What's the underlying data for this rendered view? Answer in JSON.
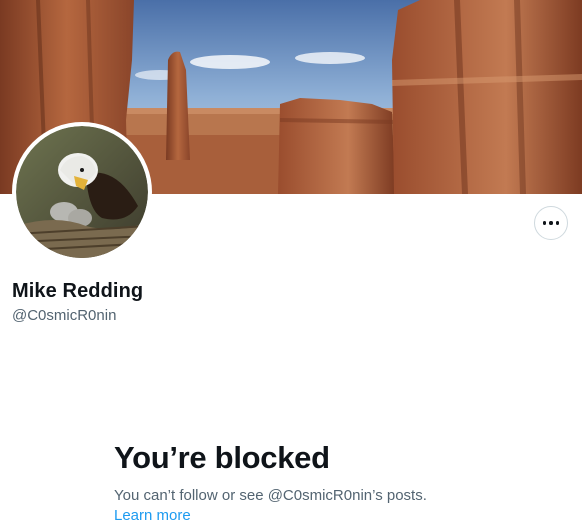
{
  "profile": {
    "display_name": "Mike Redding",
    "handle": "@C0smicR0nin"
  },
  "blocked": {
    "title": "You’re blocked",
    "message": "You can’t follow or see @C0smicR0nin’s posts.",
    "learn_more": "Learn more"
  },
  "colors": {
    "link": "#1d9bf0",
    "secondary_text": "#536471",
    "primary_text": "#0f1419"
  },
  "icons": {
    "more": "more-horizontal-icon"
  }
}
